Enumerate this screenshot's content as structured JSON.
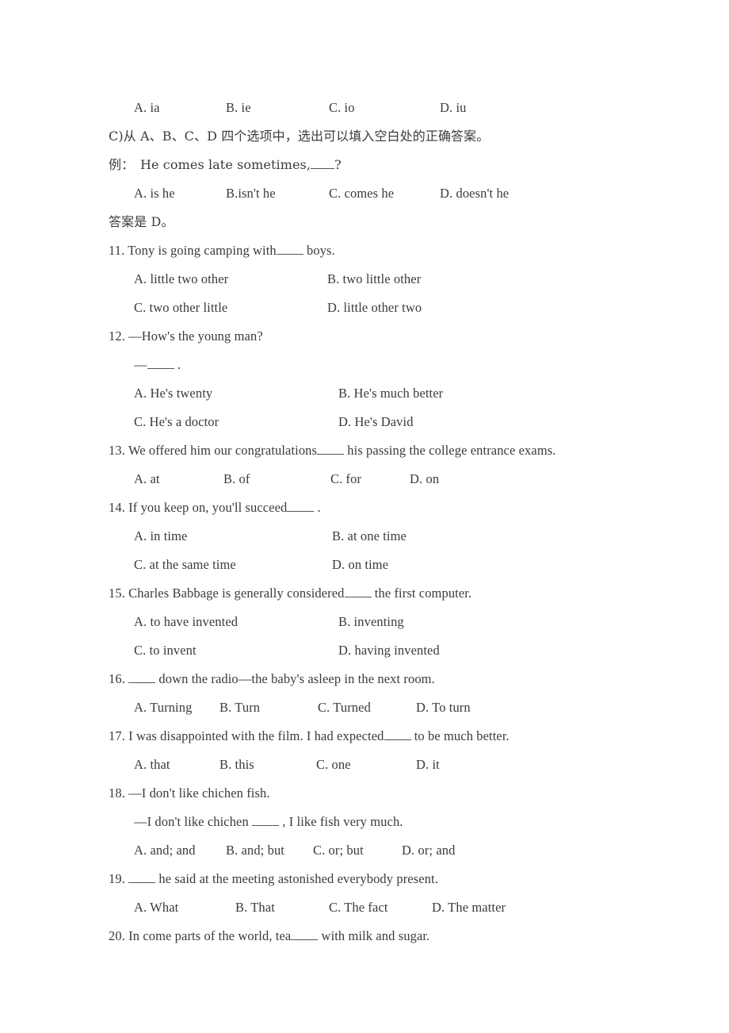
{
  "document": {
    "type": "english-exam-worksheet",
    "text_color": "#3b3b3b",
    "background_color": "#ffffff"
  },
  "top_options": {
    "a": "A. ia",
    "b": "B. ie",
    "c": "C. io",
    "d": "D. iu"
  },
  "section_c": {
    "instruction": "C)从 A、B、C、D 四个选项中，选出可以填入空白处的正确答案。",
    "example_label": "例：",
    "example_stem_before": "He comes late sometimes,",
    "example_stem_after": "?",
    "example_options": {
      "a": "A. is he",
      "b": "B.isn't he",
      "c": "C. comes he",
      "d": "D. doesn't he"
    },
    "answer_note": "答案是 D。"
  },
  "questions": [
    {
      "number": "11.",
      "stem_before": "11. Tony is going camping with",
      "stem_after": "boys.",
      "layout": "two-column",
      "options": {
        "a": "A. little two other",
        "b": "B. two little other",
        "c": "C. two other little",
        "d": "D. little other two"
      }
    },
    {
      "number": "12.",
      "stem": "12. —How's the young man?",
      "reply_prefix": "—",
      "reply_suffix": ".",
      "layout": "two-column",
      "options": {
        "a": "A. He's twenty",
        "b": "B. He's much better",
        "c": "C. He's a doctor",
        "d": "D. He's David"
      }
    },
    {
      "number": "13.",
      "stem_before": "13. We offered him our congratulations",
      "stem_after": "his passing the college entrance exams.",
      "layout": "four-column",
      "options": {
        "a": "A. at",
        "b": "B. of",
        "c": "C. for",
        "d": "D. on"
      }
    },
    {
      "number": "14.",
      "stem_before": "14. If you keep on, you'll succeed",
      "stem_after": ".",
      "layout": "two-column",
      "options": {
        "a": "A. in time",
        "b": "B. at one time",
        "c": "C. at the same time",
        "d": "D. on time"
      }
    },
    {
      "number": "15.",
      "stem_before": "15. Charles Babbage is generally considered",
      "stem_after": "the first computer.",
      "layout": "two-column",
      "options": {
        "a": "A. to have invented",
        "b": "B. inventing",
        "c": "C. to invent",
        "d": "D. having invented"
      }
    },
    {
      "number": "16.",
      "stem_before": "16.",
      "stem_after": "down the radio—the baby's asleep in the next room.",
      "layout": "four-column",
      "options": {
        "a": "A. Turning",
        "b": "B. Turn",
        "c": "C. Turned",
        "d": "D. To turn"
      }
    },
    {
      "number": "17.",
      "stem_before": "17. I was disappointed with the film. I had expected",
      "stem_after": "to be much better.",
      "layout": "four-column",
      "options": {
        "a": "A. that",
        "b": "B. this",
        "c": "C. one",
        "d": "D. it"
      }
    },
    {
      "number": "18.",
      "stem": "18. —I don't like chichen fish.",
      "reply_before": "—I don't like chichen",
      "reply_after": ", I like fish very much.",
      "layout": "four-column",
      "options": {
        "a": "A. and; and",
        "b": "B. and; but",
        "c": "C. or; but",
        "d": "D. or; and"
      }
    },
    {
      "number": "19.",
      "stem_before": "19.",
      "stem_after": "he said at the meeting astonished everybody present.",
      "layout": "four-column",
      "options": {
        "a": "A. What",
        "b": "B. That",
        "c": "C. The fact",
        "d": "D. The matter"
      }
    },
    {
      "number": "20.",
      "stem_before": "20. In come parts of the world, tea",
      "stem_after": "with milk and sugar.",
      "layout": "none",
      "options": {}
    }
  ]
}
